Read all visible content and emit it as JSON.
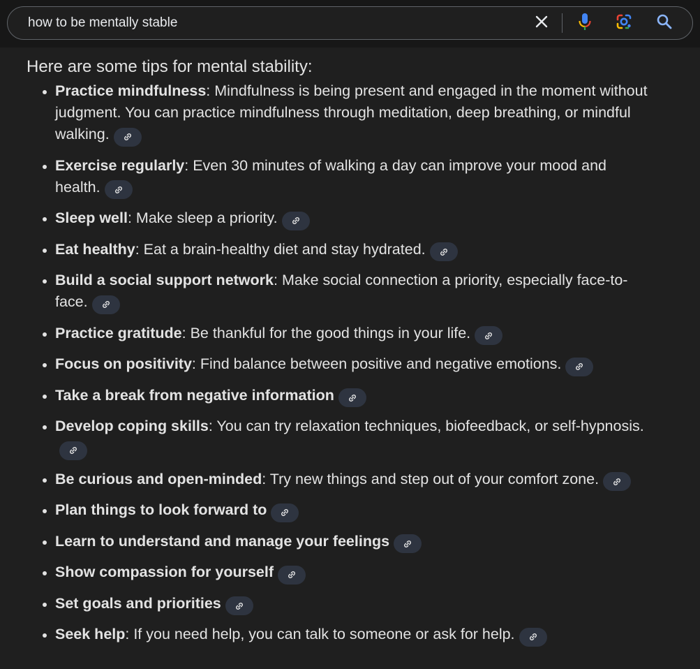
{
  "search": {
    "query": "how to be mentally stable",
    "clear_icon": "close-icon",
    "voice_icon": "microphone-icon",
    "lens_icon": "google-lens-icon",
    "submit_icon": "search-icon"
  },
  "overview": {
    "intro": "Here are some tips for mental stability:",
    "tips": [
      {
        "title": "Practice mindfulness",
        "text": ": Mindfulness is being present and engaged in the moment without judgment. You can practice mindfulness through meditation, deep breathing, or mindful walking."
      },
      {
        "title": "Exercise regularly",
        "text": ": Even 30 minutes of walking a day can improve your mood and health."
      },
      {
        "title": "Sleep well",
        "text": ": Make sleep a priority."
      },
      {
        "title": "Eat healthy",
        "text": ": Eat a brain-healthy diet and stay hydrated."
      },
      {
        "title": "Build a social support network",
        "text": ": Make social connection a priority, especially face-to-face."
      },
      {
        "title": "Practice gratitude",
        "text": ": Be thankful for the good things in your life."
      },
      {
        "title": "Focus on positivity",
        "text": ": Find balance between positive and negative emotions."
      },
      {
        "title": "Take a break from negative information",
        "text": ""
      },
      {
        "title": "Develop coping skills",
        "text": ": You can try relaxation techniques, biofeedback, or self-hypnosis."
      },
      {
        "title": "Be curious and open-minded",
        "text": ": Try new things and step out of your comfort zone."
      },
      {
        "title": "Plan things to look forward to",
        "text": ""
      },
      {
        "title": "Learn to understand and manage your feelings",
        "text": ""
      },
      {
        "title": "Show compassion for yourself",
        "text": ""
      },
      {
        "title": "Set goals and priorities",
        "text": ""
      },
      {
        "title": "Seek help",
        "text": ": If you need help, you can talk to someone or ask for help."
      }
    ],
    "link_icon": "link-icon"
  },
  "colors": {
    "background": "#1f1f1f",
    "chip": "#2e3440",
    "text": "#e3e3e3",
    "google_blue": "#4285f4",
    "google_red": "#ea4335",
    "google_yellow": "#fbbc04",
    "google_green": "#34a853"
  }
}
